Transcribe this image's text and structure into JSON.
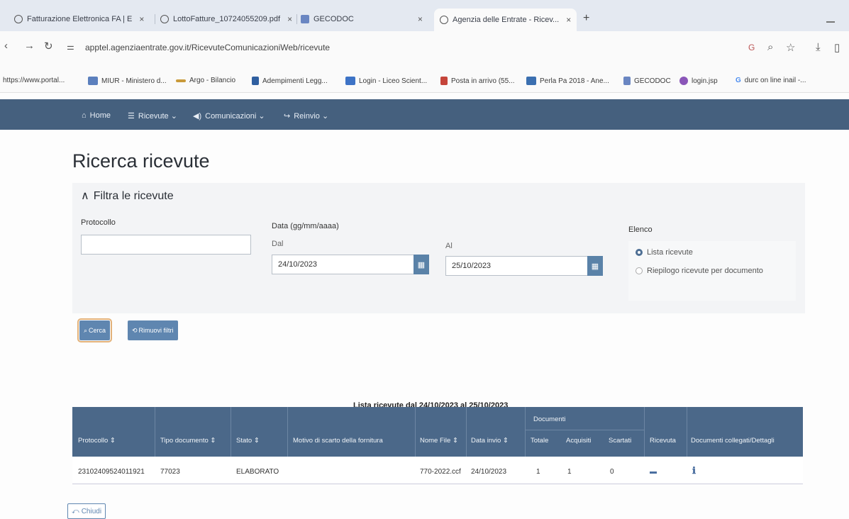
{
  "browser": {
    "tabs": [
      {
        "title": "Fatturazione Elettronica FA | E"
      },
      {
        "title": "LottoFatture_10724055209.pdf"
      },
      {
        "title": "GECODOC"
      },
      {
        "title": "Agenzia delle Entrate - Ricev..."
      }
    ],
    "url": "apptel.agenziaentrate.gov.it/RicevuteComunicazioniWeb/ricevute",
    "bookmarks": [
      {
        "label": "https://www.portal...",
        "color": "#bbbbbb"
      },
      {
        "label": "MIUR - Ministero d...",
        "color": "#5b7fbd"
      },
      {
        "label": "Argo - Bilancio",
        "color": "#c99a3a"
      },
      {
        "label": "Adempimenti Legg...",
        "color": "#2f5fa0"
      },
      {
        "label": "Login - Liceo Scient...",
        "color": "#3d73c6"
      },
      {
        "label": "Posta in arrivo (55...",
        "color": "#c5443a"
      },
      {
        "label": "Perla Pa 2018 - Ane...",
        "color": "#3b6fb0"
      },
      {
        "label": "GECODOC",
        "color": "#6a86c2"
      },
      {
        "label": "login.jsp",
        "color": "#8a56b8"
      },
      {
        "label": "durc on line inail -...",
        "color": "#4a8cf0"
      }
    ]
  },
  "nav": {
    "home": "Home",
    "ricevute": "Ricevute",
    "comunicazioni": "Comunicazioni",
    "reinvio": "Reinvio"
  },
  "page": {
    "title": "Ricerca ricevute",
    "filter_title": "Filtra le ricevute"
  },
  "filters": {
    "protocollo_label": "Protocollo",
    "protocollo_value": "",
    "data_label": "Data (gg/mm/aaaa)",
    "dal_label": "Dal",
    "dal_value": "24/10/2023",
    "al_label": "Al",
    "al_value": "25/10/2023",
    "elenco_label": "Elenco",
    "elenco_options": [
      {
        "label": "Lista ricevute",
        "selected": true
      },
      {
        "label": "Riepilogo ricevute per documento",
        "selected": false
      }
    ],
    "search_button": "Cerca",
    "reset_button": "Rimuovi filtri"
  },
  "results": {
    "caption": "Lista ricevute dal 24/10/2023 al 25/10/2023",
    "group_header": "Documenti",
    "columns": [
      "Protocollo",
      "Tipo documento",
      "Stato",
      "Motivo di scarto della fornitura",
      "Nome File",
      "Data invio",
      "Totale",
      "Acquisiti",
      "Scartati",
      "Ricevuta",
      "Documenti collegati/Dettagli"
    ],
    "rows": [
      {
        "protocollo": "23102409524011921",
        "tipo": "77023",
        "stato": "ELABORATO",
        "motivo": "",
        "nome_file": "770-2022.ccf",
        "data_invio": "24/10/2023",
        "totale": "1",
        "acquisiti": "1",
        "scartati": "0"
      }
    ]
  },
  "footer": {
    "close_button": "Chiudi"
  },
  "colors": {
    "nav_bg": "#45607e",
    "table_header": "#4b6889",
    "button": "#5f86b0"
  }
}
